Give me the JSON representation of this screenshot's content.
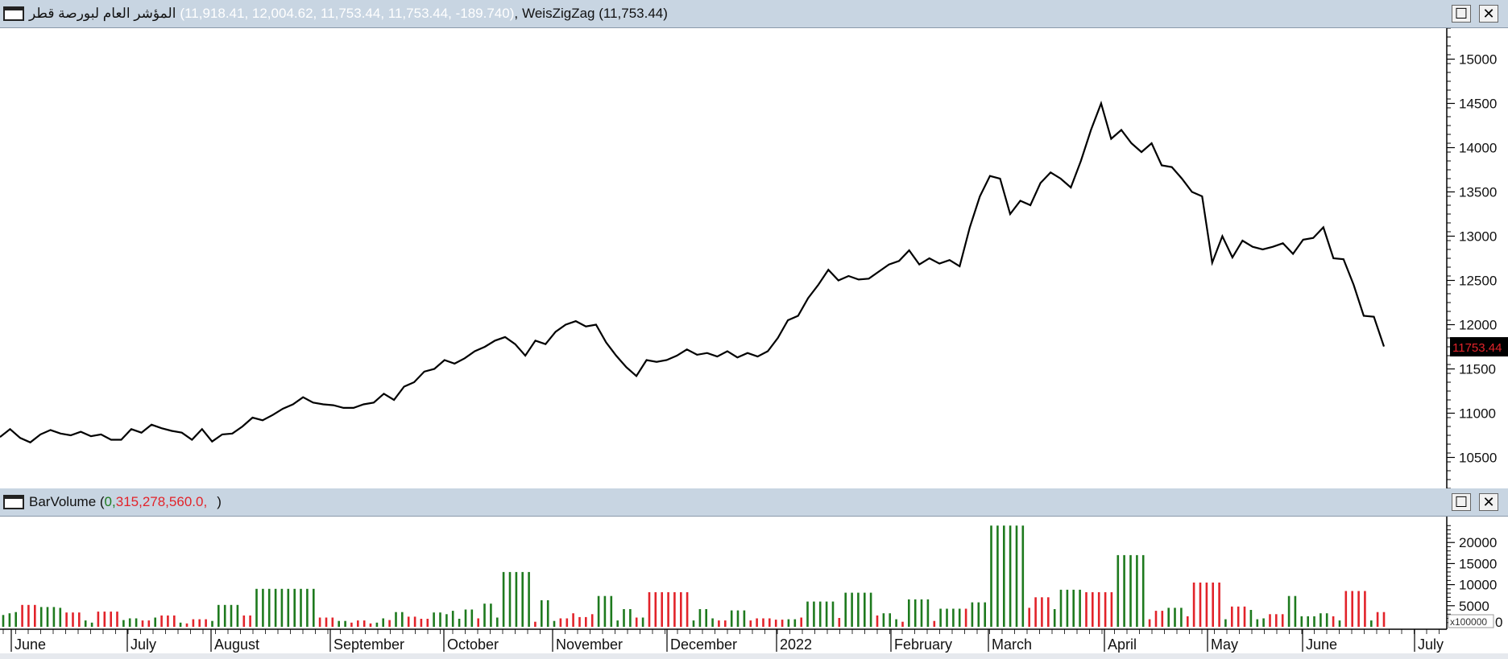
{
  "price_panel": {
    "symbol_name": "المؤشر العام لبورصة قطر",
    "ohlc": "(11,918.41, 12,004.62, 11,753.44, 11,753.44, -189.740)",
    "separator": ",",
    "indicator_label": "WeisZigZag (11,753.44)",
    "last_price": "11753.44"
  },
  "volume_panel": {
    "indicator_name": "BarVolume (",
    "val_zero": "0,",
    "val_volume": " 315,278,560.0,",
    "val_close": ")",
    "multiplier": "x100000",
    "multiplier_zero": "0"
  },
  "buttons": {
    "maximize": "☐",
    "close": "✕"
  },
  "colors": {
    "up": "#1e7a1e",
    "down": "#e2232a",
    "line": "#000000",
    "title_bg": "#c8d5e2",
    "dim_text": "#ffffff"
  },
  "chart_data": [
    {
      "type": "line",
      "title": "",
      "ylim": [
        10150,
        15350
      ],
      "y_ticks": [
        10500,
        11000,
        11500,
        12000,
        12500,
        13000,
        13500,
        14000,
        14500,
        15000
      ],
      "x_labels": [
        "June",
        "July",
        "August",
        "September",
        "October",
        "November",
        "December",
        "2022",
        "February",
        "March",
        "April",
        "May",
        "June",
        "July"
      ],
      "series": [
        {
          "values": [
            10730,
            10820,
            10720,
            10670,
            10760,
            10810,
            10770,
            10750,
            10790,
            10740,
            10760,
            10700,
            10700,
            10820,
            10780,
            10870,
            10830,
            10800,
            10780,
            10700,
            10820,
            10680,
            10760,
            10770,
            10850,
            10950,
            10920,
            10980,
            11050,
            11100,
            11180,
            11120,
            11100,
            11090,
            11060,
            11060,
            11100,
            11120,
            11220,
            11150,
            11300,
            11350,
            11470,
            11500,
            11600,
            11560,
            11620,
            11700,
            11750,
            11820,
            11860,
            11780,
            11650,
            11820,
            11780,
            11920,
            12000,
            12040,
            11980,
            12000,
            11800,
            11650,
            11520,
            11420,
            11600,
            11580,
            11600,
            11650,
            11720,
            11660,
            11680,
            11640,
            11700,
            11630,
            11680,
            11640,
            11700,
            11850,
            12050,
            12100,
            12300,
            12450,
            12620,
            12500,
            12550,
            12510,
            12520,
            12600,
            12680,
            12720,
            12840,
            12680,
            12750,
            12690,
            12730,
            12660,
            13100,
            13450,
            13680,
            13650,
            13250,
            13400,
            13350,
            13600,
            13720,
            13650,
            13550,
            13850,
            14200,
            14500,
            14100,
            14200,
            14050,
            13950,
            14050,
            13800,
            13780,
            13650,
            13500,
            13450,
            12700,
            13000,
            12760,
            12950,
            12880,
            12850,
            12880,
            12920,
            12800,
            12960,
            12980,
            13100,
            12750,
            12740,
            12450,
            12100,
            12090,
            11753.44
          ]
        }
      ]
    },
    {
      "type": "bar",
      "title": "",
      "ylim": [
        0,
        25000
      ],
      "y_ticks": [
        0,
        5000,
        10000,
        15000,
        20000
      ],
      "y_multiplier": "x100000",
      "bars": [
        {
          "v": 2800,
          "c": "g"
        },
        {
          "v": 3200,
          "c": "g"
        },
        {
          "v": 3500,
          "c": "g"
        },
        {
          "v": 5200,
          "c": "r"
        },
        {
          "v": 5200,
          "c": "r"
        },
        {
          "v": 5200,
          "c": "r"
        },
        {
          "v": 4700,
          "c": "g"
        },
        {
          "v": 4700,
          "c": "g"
        },
        {
          "v": 4700,
          "c": "g"
        },
        {
          "v": 4500,
          "c": "g"
        },
        {
          "v": 3400,
          "c": "r"
        },
        {
          "v": 3400,
          "c": "r"
        },
        {
          "v": 3400,
          "c": "r"
        },
        {
          "v": 1500,
          "c": "g"
        },
        {
          "v": 1000,
          "c": "g"
        },
        {
          "v": 3600,
          "c": "r"
        },
        {
          "v": 3600,
          "c": "r"
        },
        {
          "v": 3600,
          "c": "r"
        },
        {
          "v": 3600,
          "c": "r"
        },
        {
          "v": 1600,
          "c": "g"
        },
        {
          "v": 2000,
          "c": "g"
        },
        {
          "v": 2000,
          "c": "g"
        },
        {
          "v": 1500,
          "c": "r"
        },
        {
          "v": 1500,
          "c": "r"
        },
        {
          "v": 2200,
          "c": "g"
        },
        {
          "v": 2700,
          "c": "r"
        },
        {
          "v": 2700,
          "c": "r"
        },
        {
          "v": 2700,
          "c": "r"
        },
        {
          "v": 1000,
          "c": "g"
        },
        {
          "v": 800,
          "c": "r"
        },
        {
          "v": 1800,
          "c": "r"
        },
        {
          "v": 1800,
          "c": "r"
        },
        {
          "v": 1800,
          "c": "r"
        },
        {
          "v": 1400,
          "c": "g"
        },
        {
          "v": 5200,
          "c": "g"
        },
        {
          "v": 5200,
          "c": "g"
        },
        {
          "v": 5200,
          "c": "g"
        },
        {
          "v": 5200,
          "c": "g"
        },
        {
          "v": 2700,
          "c": "r"
        },
        {
          "v": 2700,
          "c": "r"
        },
        {
          "v": 9000,
          "c": "g"
        },
        {
          "v": 9000,
          "c": "g"
        },
        {
          "v": 9000,
          "c": "g"
        },
        {
          "v": 9000,
          "c": "g"
        },
        {
          "v": 9000,
          "c": "g"
        },
        {
          "v": 9000,
          "c": "g"
        },
        {
          "v": 9000,
          "c": "g"
        },
        {
          "v": 9000,
          "c": "g"
        },
        {
          "v": 9000,
          "c": "g"
        },
        {
          "v": 9000,
          "c": "g"
        },
        {
          "v": 2200,
          "c": "r"
        },
        {
          "v": 2200,
          "c": "r"
        },
        {
          "v": 2200,
          "c": "r"
        },
        {
          "v": 1400,
          "c": "g"
        },
        {
          "v": 1400,
          "c": "g"
        },
        {
          "v": 1000,
          "c": "r"
        },
        {
          "v": 1500,
          "c": "r"
        },
        {
          "v": 1500,
          "c": "r"
        },
        {
          "v": 800,
          "c": "r"
        },
        {
          "v": 1000,
          "c": "g"
        },
        {
          "v": 2000,
          "c": "g"
        },
        {
          "v": 1600,
          "c": "r"
        },
        {
          "v": 3500,
          "c": "g"
        },
        {
          "v": 3500,
          "c": "g"
        },
        {
          "v": 2400,
          "c": "r"
        },
        {
          "v": 2400,
          "c": "r"
        },
        {
          "v": 1900,
          "c": "r"
        },
        {
          "v": 1900,
          "c": "r"
        },
        {
          "v": 3400,
          "c": "g"
        },
        {
          "v": 3400,
          "c": "g"
        },
        {
          "v": 3000,
          "c": "g"
        },
        {
          "v": 3800,
          "c": "g"
        },
        {
          "v": 1900,
          "c": "g"
        },
        {
          "v": 4100,
          "c": "g"
        },
        {
          "v": 4100,
          "c": "g"
        },
        {
          "v": 2000,
          "c": "r"
        },
        {
          "v": 5500,
          "c": "g"
        },
        {
          "v": 5500,
          "c": "g"
        },
        {
          "v": 2200,
          "c": "g"
        },
        {
          "v": 13000,
          "c": "g"
        },
        {
          "v": 13000,
          "c": "g"
        },
        {
          "v": 13000,
          "c": "g"
        },
        {
          "v": 13000,
          "c": "g"
        },
        {
          "v": 13000,
          "c": "g"
        },
        {
          "v": 1200,
          "c": "r"
        },
        {
          "v": 6300,
          "c": "g"
        },
        {
          "v": 6300,
          "c": "g"
        },
        {
          "v": 1400,
          "c": "g"
        },
        {
          "v": 2000,
          "c": "r"
        },
        {
          "v": 2000,
          "c": "r"
        },
        {
          "v": 3200,
          "c": "r"
        },
        {
          "v": 2300,
          "c": "r"
        },
        {
          "v": 2300,
          "c": "r"
        },
        {
          "v": 3000,
          "c": "r"
        },
        {
          "v": 7300,
          "c": "g"
        },
        {
          "v": 7300,
          "c": "g"
        },
        {
          "v": 7300,
          "c": "g"
        },
        {
          "v": 1500,
          "c": "g"
        },
        {
          "v": 4200,
          "c": "g"
        },
        {
          "v": 4200,
          "c": "g"
        },
        {
          "v": 2200,
          "c": "r"
        },
        {
          "v": 2200,
          "c": "g"
        },
        {
          "v": 8200,
          "c": "r"
        },
        {
          "v": 8200,
          "c": "r"
        },
        {
          "v": 8200,
          "c": "r"
        },
        {
          "v": 8200,
          "c": "r"
        },
        {
          "v": 8200,
          "c": "r"
        },
        {
          "v": 8200,
          "c": "r"
        },
        {
          "v": 8200,
          "c": "r"
        },
        {
          "v": 1500,
          "c": "g"
        },
        {
          "v": 4200,
          "c": "g"
        },
        {
          "v": 4200,
          "c": "g"
        },
        {
          "v": 2000,
          "c": "g"
        },
        {
          "v": 1500,
          "c": "r"
        },
        {
          "v": 1500,
          "c": "r"
        },
        {
          "v": 3900,
          "c": "g"
        },
        {
          "v": 3900,
          "c": "g"
        },
        {
          "v": 3900,
          "c": "g"
        },
        {
          "v": 1500,
          "c": "r"
        },
        {
          "v": 2000,
          "c": "r"
        },
        {
          "v": 2000,
          "c": "r"
        },
        {
          "v": 2000,
          "c": "r"
        },
        {
          "v": 1700,
          "c": "r"
        },
        {
          "v": 1700,
          "c": "r"
        },
        {
          "v": 1800,
          "c": "g"
        },
        {
          "v": 1800,
          "c": "g"
        },
        {
          "v": 2200,
          "c": "r"
        },
        {
          "v": 6000,
          "c": "g"
        },
        {
          "v": 6000,
          "c": "g"
        },
        {
          "v": 6000,
          "c": "g"
        },
        {
          "v": 6000,
          "c": "g"
        },
        {
          "v": 6000,
          "c": "g"
        },
        {
          "v": 2100,
          "c": "r"
        },
        {
          "v": 8100,
          "c": "g"
        },
        {
          "v": 8100,
          "c": "g"
        },
        {
          "v": 8100,
          "c": "g"
        },
        {
          "v": 8100,
          "c": "g"
        },
        {
          "v": 8100,
          "c": "g"
        },
        {
          "v": 2700,
          "c": "r"
        },
        {
          "v": 3200,
          "c": "g"
        },
        {
          "v": 3200,
          "c": "g"
        },
        {
          "v": 1800,
          "c": "g"
        },
        {
          "v": 1200,
          "c": "r"
        },
        {
          "v": 6500,
          "c": "g"
        },
        {
          "v": 6500,
          "c": "g"
        },
        {
          "v": 6500,
          "c": "g"
        },
        {
          "v": 6500,
          "c": "g"
        },
        {
          "v": 1400,
          "c": "r"
        },
        {
          "v": 4300,
          "c": "g"
        },
        {
          "v": 4300,
          "c": "g"
        },
        {
          "v": 4300,
          "c": "g"
        },
        {
          "v": 4300,
          "c": "g"
        },
        {
          "v": 4300,
          "c": "r"
        },
        {
          "v": 5800,
          "c": "g"
        },
        {
          "v": 5800,
          "c": "g"
        },
        {
          "v": 5800,
          "c": "g"
        },
        {
          "v": 24000,
          "c": "g"
        },
        {
          "v": 24000,
          "c": "g"
        },
        {
          "v": 24000,
          "c": "g"
        },
        {
          "v": 24000,
          "c": "g"
        },
        {
          "v": 24000,
          "c": "g"
        },
        {
          "v": 24000,
          "c": "g"
        },
        {
          "v": 4500,
          "c": "r"
        },
        {
          "v": 7000,
          "c": "r"
        },
        {
          "v": 7000,
          "c": "r"
        },
        {
          "v": 7000,
          "c": "r"
        },
        {
          "v": 4200,
          "c": "g"
        },
        {
          "v": 8800,
          "c": "g"
        },
        {
          "v": 8800,
          "c": "g"
        },
        {
          "v": 8800,
          "c": "g"
        },
        {
          "v": 8800,
          "c": "g"
        },
        {
          "v": 8200,
          "c": "r"
        },
        {
          "v": 8200,
          "c": "r"
        },
        {
          "v": 8200,
          "c": "r"
        },
        {
          "v": 8200,
          "c": "r"
        },
        {
          "v": 8200,
          "c": "r"
        },
        {
          "v": 17000,
          "c": "g"
        },
        {
          "v": 17000,
          "c": "g"
        },
        {
          "v": 17000,
          "c": "g"
        },
        {
          "v": 17000,
          "c": "g"
        },
        {
          "v": 17000,
          "c": "g"
        },
        {
          "v": 1800,
          "c": "r"
        },
        {
          "v": 3800,
          "c": "r"
        },
        {
          "v": 3800,
          "c": "r"
        },
        {
          "v": 4500,
          "c": "g"
        },
        {
          "v": 4500,
          "c": "g"
        },
        {
          "v": 4500,
          "c": "g"
        },
        {
          "v": 2500,
          "c": "r"
        },
        {
          "v": 10500,
          "c": "r"
        },
        {
          "v": 10500,
          "c": "r"
        },
        {
          "v": 10500,
          "c": "r"
        },
        {
          "v": 10500,
          "c": "r"
        },
        {
          "v": 10500,
          "c": "r"
        },
        {
          "v": 1800,
          "c": "g"
        },
        {
          "v": 4800,
          "c": "r"
        },
        {
          "v": 4800,
          "c": "r"
        },
        {
          "v": 4800,
          "c": "r"
        },
        {
          "v": 4000,
          "c": "g"
        },
        {
          "v": 1800,
          "c": "g"
        },
        {
          "v": 2000,
          "c": "g"
        },
        {
          "v": 3000,
          "c": "r"
        },
        {
          "v": 3000,
          "c": "r"
        },
        {
          "v": 3000,
          "c": "r"
        },
        {
          "v": 7300,
          "c": "g"
        },
        {
          "v": 7300,
          "c": "g"
        },
        {
          "v": 2500,
          "c": "g"
        },
        {
          "v": 2500,
          "c": "g"
        },
        {
          "v": 2500,
          "c": "g"
        },
        {
          "v": 3200,
          "c": "g"
        },
        {
          "v": 3200,
          "c": "g"
        },
        {
          "v": 2500,
          "c": "r"
        },
        {
          "v": 1500,
          "c": "g"
        },
        {
          "v": 8500,
          "c": "r"
        },
        {
          "v": 8500,
          "c": "r"
        },
        {
          "v": 8500,
          "c": "r"
        },
        {
          "v": 8500,
          "c": "r"
        },
        {
          "v": 1500,
          "c": "g"
        },
        {
          "v": 3500,
          "c": "r"
        },
        {
          "v": 3500,
          "c": "r"
        }
      ]
    }
  ]
}
